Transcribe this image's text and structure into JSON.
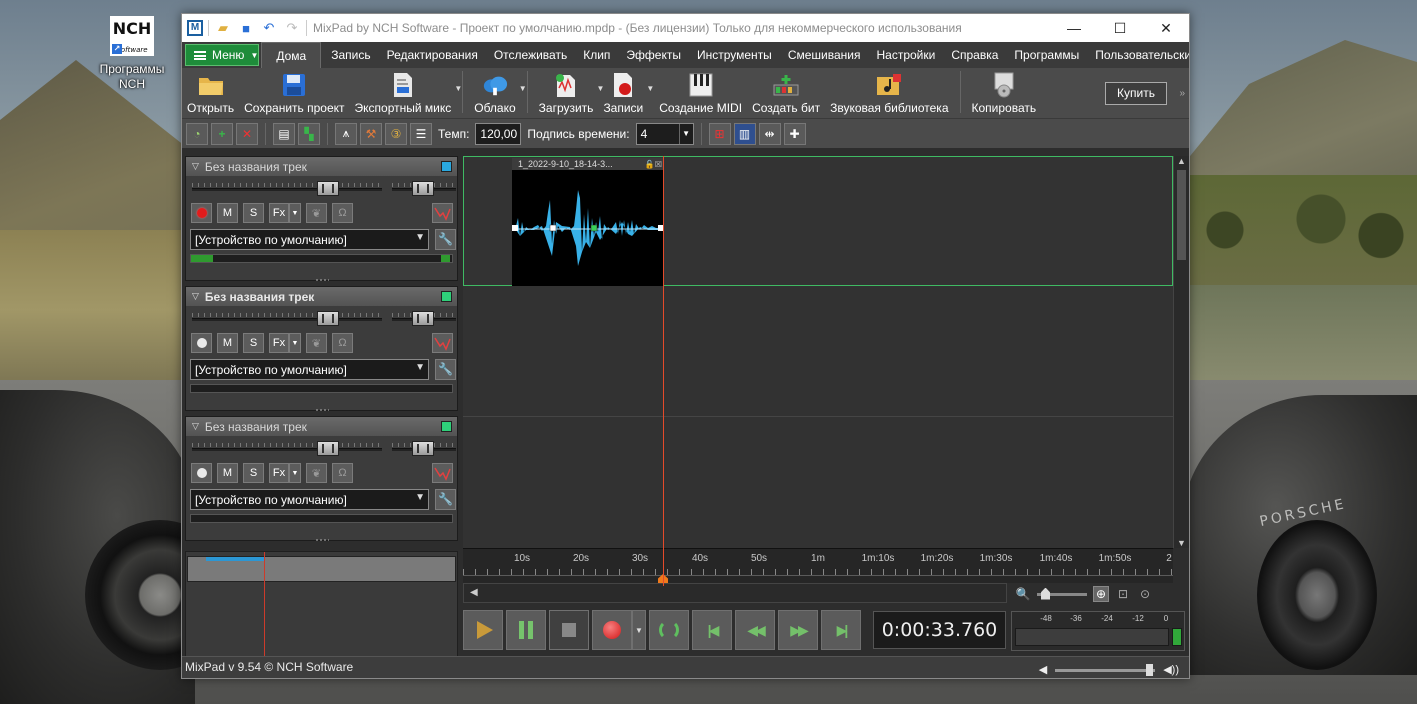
{
  "desktop": {
    "icon_logo": "NCH",
    "icon_logo_sub": "Software",
    "icon_label": "Программы NCH",
    "car_text": "PORSCHE"
  },
  "window": {
    "title": "MixPad by NCH Software - Проект по умолчанию.mpdp - (Без лицензии) Только для некоммерческого использования",
    "minimize": "—",
    "maximize": "☐",
    "close": "✕"
  },
  "tabs": {
    "menu_label": "Меню",
    "items": [
      "Дома",
      "Запись",
      "Редактирования",
      "Отслеживать",
      "Клип",
      "Эффекты",
      "Инструменты",
      "Смешивания",
      "Настройки",
      "Справка",
      "Программы",
      "Пользовательский"
    ],
    "active_index": 0,
    "help": "?"
  },
  "toolbar": {
    "open": "Открыть",
    "save_project": "Сохранить проект",
    "export_mix": "Экспортный микс",
    "cloud": "Облако",
    "load": "Загрузить",
    "records": "Записи",
    "create_midi": "Создание MIDI",
    "create_beat": "Создать бит",
    "sound_library": "Звуковая библиотека",
    "copy": "Копировать",
    "buy": "Купить",
    "more": "»"
  },
  "toolbar2": {
    "tempo_label": "Темп:",
    "tempo_value": "120,00",
    "time_signature_label": "Подпись времени:",
    "time_signature_value": "4"
  },
  "tracks": [
    {
      "name": "Без названия трек",
      "color": "#2aa9e0",
      "device": "[Устройство по умолчанию]",
      "bold": false,
      "armed": true
    },
    {
      "name": "Без названия трек",
      "color": "#2fd07a",
      "device": "[Устройство по умолчанию]",
      "bold": true,
      "armed": false
    },
    {
      "name": "Без названия трек",
      "color": "#2fd07a",
      "device": "[Устройство по умолчанию]",
      "bold": false,
      "armed": false
    }
  ],
  "track_buttons": {
    "mute": "M",
    "solo": "S",
    "fx": "Fx"
  },
  "clip": {
    "name": "1_2022-9-10_18-14-3..."
  },
  "ruler": {
    "labels": [
      "10s",
      "20s",
      "30s",
      "40s",
      "50s",
      "1m",
      "1m:10s",
      "1m:20s",
      "1m:30s",
      "1m:40s",
      "1m:50s",
      "2"
    ]
  },
  "transport": {
    "time": "0:00:33.760"
  },
  "levels": {
    "labels": [
      "-48",
      "-36",
      "-24",
      "-12",
      "0"
    ]
  },
  "status": {
    "version": "MixPad v 9.54 © NCH Software"
  }
}
